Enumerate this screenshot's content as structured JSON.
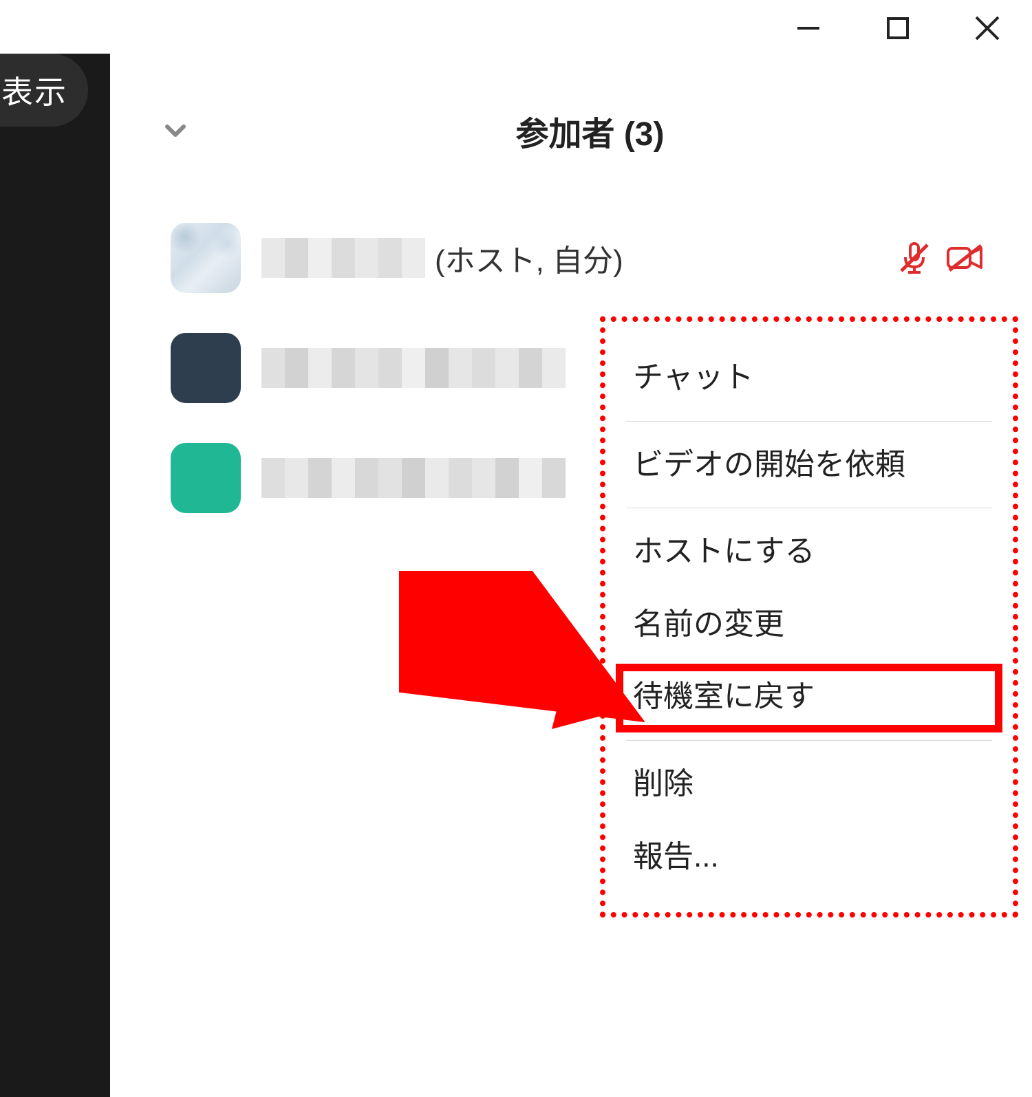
{
  "sidebar": {
    "pill_label": "表示"
  },
  "header": {
    "title": "参加者 (3)"
  },
  "participants": {
    "row1": {
      "role_suffix": "(ホスト, 自分)"
    }
  },
  "context_menu": {
    "items": {
      "chat": "チャット",
      "ask_start_video": "ビデオの開始を依頼",
      "make_host": "ホストにする",
      "rename": "名前の変更",
      "put_in_waiting_room": "待機室に戻す",
      "remove": "削除",
      "report": "報告..."
    }
  },
  "colors": {
    "annotation_red": "#ff0000",
    "mic_muted_red": "#e02c2c"
  }
}
